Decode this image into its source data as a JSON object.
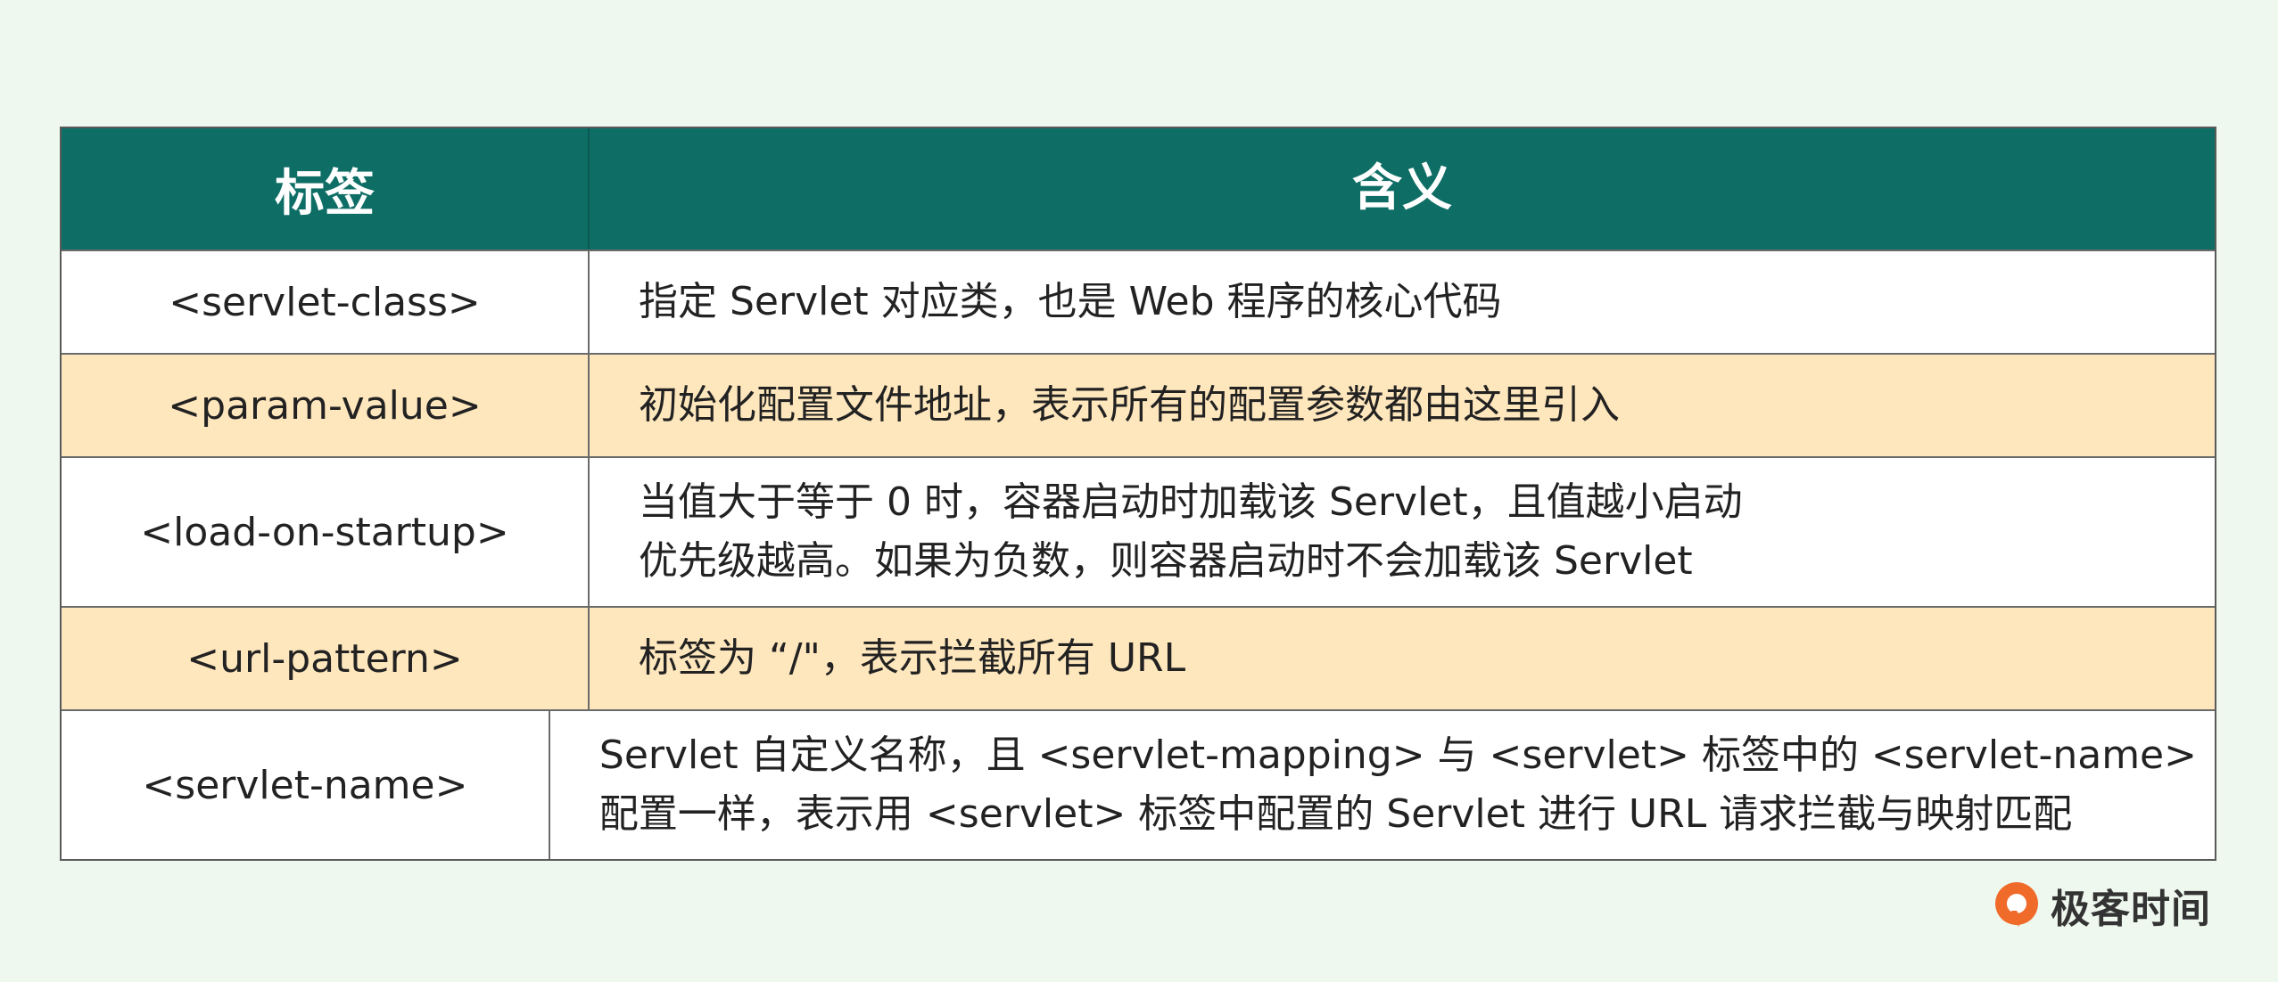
{
  "table": {
    "headers": [
      "标签",
      "含义"
    ],
    "rows": [
      {
        "tag": "<servlet-class>",
        "meaning": [
          "指定 Servlet 对应类，也是 Web 程序的核心代码"
        ]
      },
      {
        "tag": "<param-value>",
        "meaning": [
          "初始化配置文件地址，表示所有的配置参数都由这里引入"
        ]
      },
      {
        "tag": "<load-on-startup>",
        "meaning": [
          "当值大于等于 0 时，容器启动时加载该 Servlet，且值越小启动",
          "优先级越高。如果为负数，则容器启动时不会加载该 Servlet"
        ]
      },
      {
        "tag": "<url-pattern>",
        "meaning": [
          "标签为 “/\"，表示拦截所有 URL"
        ]
      },
      {
        "tag": "<servlet-name>",
        "meaning": [
          "Servlet 自定义名称，且 <servlet-mapping> 与 <servlet> 标签中的 <servlet-name>",
          "配置一样，表示用 <servlet> 标签中配置的 Servlet 进行 URL 请求拦截与映射匹配"
        ]
      }
    ]
  },
  "logo": {
    "text": "极客时间",
    "icon": "geektime-logo-icon",
    "color": "#f06a2a"
  },
  "colors": {
    "header_bg": "#0e6e66",
    "row_alt_bg": "#ffe7bd",
    "page_bg": "#eef8ee"
  }
}
